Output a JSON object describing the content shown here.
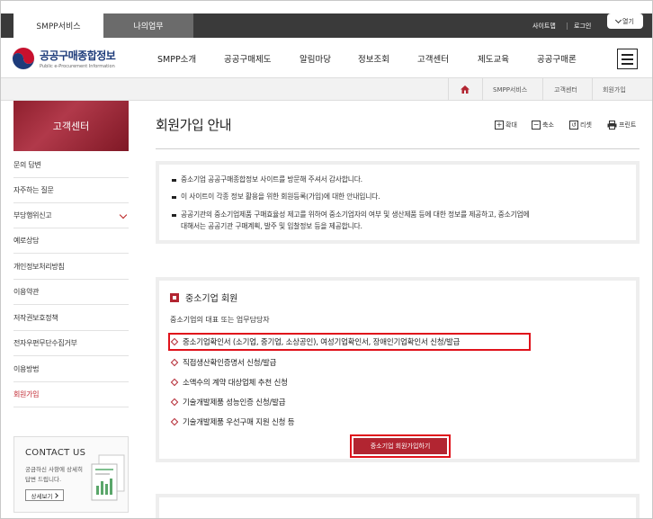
{
  "topbar": {
    "tabs": [
      {
        "label": "SMPP서비스"
      },
      {
        "label": "나의업무"
      }
    ],
    "links": {
      "sitemap": "사이트맵",
      "login": "로그인"
    },
    "open_button": "열기"
  },
  "header": {
    "logo_title": "공공구매종합정보",
    "logo_subtitle": "Public e-Procurement Information",
    "nav": [
      "SMPP소개",
      "공공구매제도",
      "알림마당",
      "정보조회",
      "고객센터",
      "제도교육",
      "공공구매론"
    ]
  },
  "breadcrumb": [
    "SMPP서비스",
    "고객센터",
    "회원가입"
  ],
  "sidebar": {
    "banner": "고객센터",
    "items": [
      {
        "label": "문의 답변"
      },
      {
        "label": "자주하는 질문"
      },
      {
        "label": "부당행위신고"
      },
      {
        "label": "예로상담"
      },
      {
        "label": "개인정보처리방침"
      },
      {
        "label": "이용약관"
      },
      {
        "label": "저작권보호정책"
      },
      {
        "label": "전자우편무단수집거부"
      },
      {
        "label": "이용방법"
      },
      {
        "label": "회원가입"
      }
    ],
    "contact": {
      "title": "CONTACT US",
      "desc_line1": "궁금하신 사항에 상세히",
      "desc_line2": "답변 드립니다.",
      "button": "상세보기"
    }
  },
  "main": {
    "title": "회원가입 안내",
    "tools": {
      "zoom_in": "확대",
      "zoom_out": "축소",
      "reset": "리셋",
      "print": "프린트"
    },
    "intro": [
      "중소기업 공공구매종합정보 사이트를 방문해 주셔서 감사합니다.",
      "이 사이트이 각종 정보 활용을 위한 회원등록(가입)에 대한 안내입니다.",
      "공공기관의 중소기업제품 구매효율성 제고를 위하여 중소기업자의 여부 및 생산제품 등에 대한 정보를 제공하고, 중소기업에",
      "대해서는 공공기관 구매계획, 발주 및 입찰정보 등을 제공합니다."
    ],
    "member": {
      "title": "중소기업 회원",
      "subtitle": "중소기업의 대표 또는 업무담당자",
      "items": [
        "중소기업확인서 (소기업, 중기업, 소상공인), 여성기업확인서, 장애인기업확인서 신청/발급",
        "직접생산확인증명서 신청/발급",
        "소액수의 계약 대상업체 추천 신청",
        "기술개발제품 성능인증 신청/발급",
        "기술개발제품 우선구매 지원 신청 등"
      ],
      "join_button": "중소기업 회원가입하기"
    }
  },
  "colors": {
    "accent": "#b22531",
    "highlight": "#e0121b",
    "topbar": "#3a3a3a"
  }
}
